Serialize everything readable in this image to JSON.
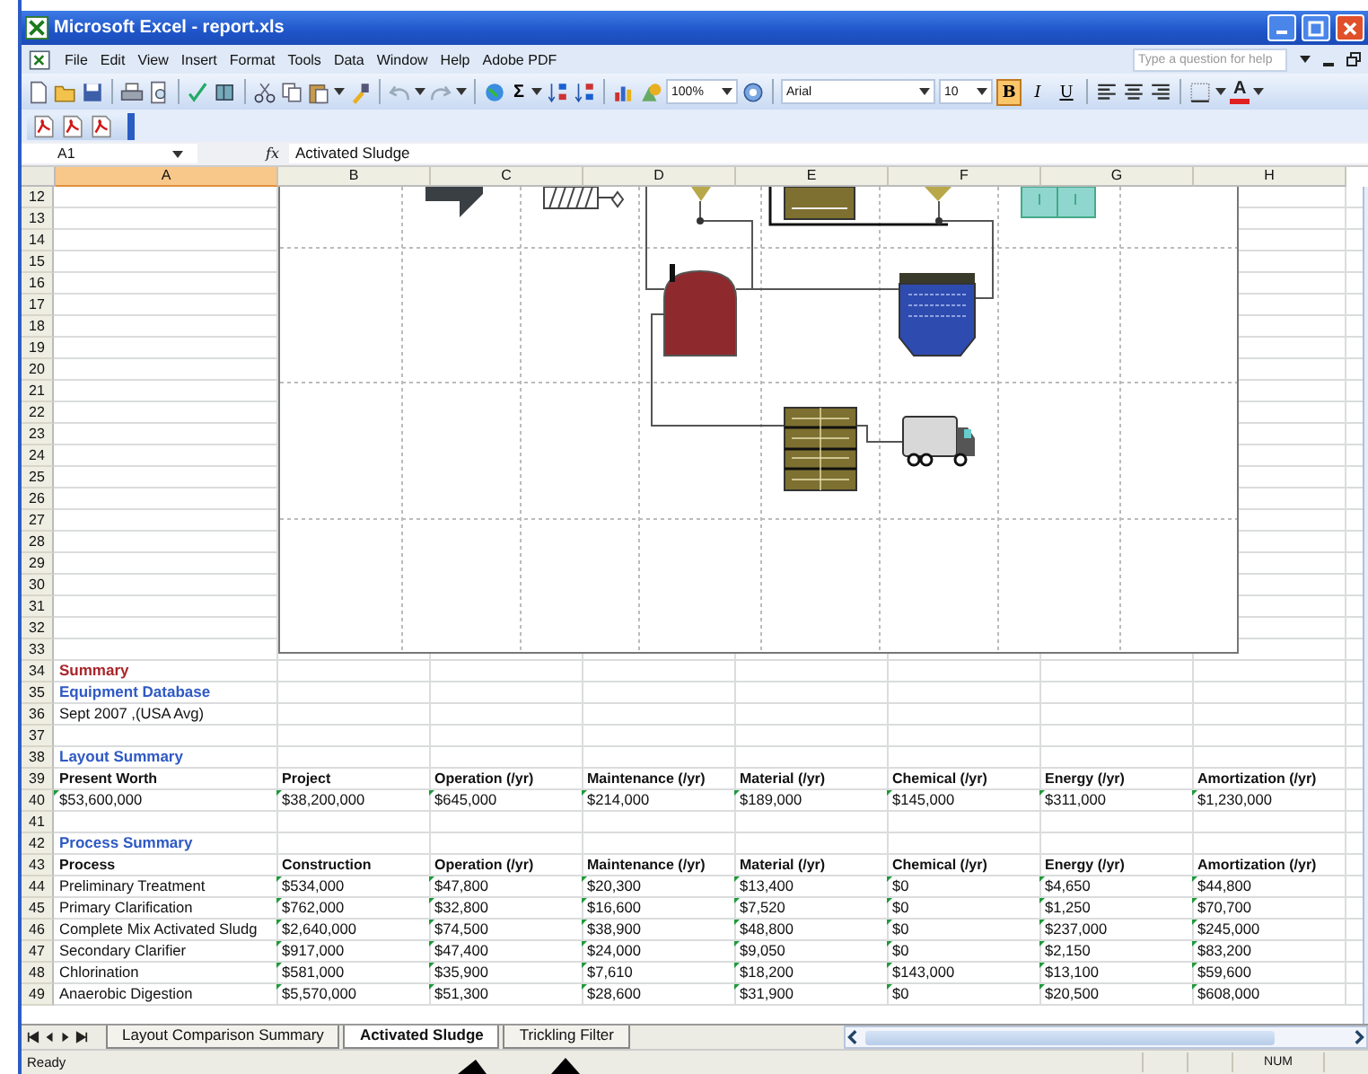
{
  "window": {
    "title": "Microsoft Excel - report.xls"
  },
  "menu": {
    "items": [
      "File",
      "Edit",
      "View",
      "Insert",
      "Format",
      "Tools",
      "Data",
      "Window",
      "Help",
      "Adobe PDF"
    ],
    "help_placeholder": "Type a question for help"
  },
  "toolbar": {
    "sum": "Σ",
    "zoom": "100%",
    "font": "Arial",
    "size": "10",
    "styles": [
      {
        "label": "B",
        "kind": "bold",
        "on": true
      },
      {
        "label": "I",
        "kind": "italic",
        "on": false
      },
      {
        "label": "U",
        "kind": "underline",
        "on": false
      }
    ],
    "font_color": "A"
  },
  "formula_bar": {
    "name_box": "A1",
    "fx": "fx",
    "value": "Activated Sludge"
  },
  "columns": [
    {
      "label": "A",
      "selected": true
    },
    {
      "label": "B",
      "selected": false
    },
    {
      "label": "C",
      "selected": false
    },
    {
      "label": "D",
      "selected": false
    },
    {
      "label": "E",
      "selected": false
    },
    {
      "label": "F",
      "selected": false
    },
    {
      "label": "G",
      "selected": false
    },
    {
      "label": "H",
      "selected": false
    }
  ],
  "rows": [
    {
      "number": "12",
      "kind": "blank"
    },
    {
      "number": "13",
      "kind": "blank"
    },
    {
      "number": "14",
      "kind": "blank"
    },
    {
      "number": "15",
      "kind": "blank"
    },
    {
      "number": "16",
      "kind": "blank"
    },
    {
      "number": "17",
      "kind": "blank"
    },
    {
      "number": "18",
      "kind": "blank"
    },
    {
      "number": "19",
      "kind": "blank"
    },
    {
      "number": "20",
      "kind": "blank"
    },
    {
      "number": "21",
      "kind": "blank"
    },
    {
      "number": "22",
      "kind": "blank"
    },
    {
      "number": "23",
      "kind": "blank"
    },
    {
      "number": "24",
      "kind": "blank"
    },
    {
      "number": "25",
      "kind": "blank"
    },
    {
      "number": "26",
      "kind": "blank"
    },
    {
      "number": "27",
      "kind": "blank"
    },
    {
      "number": "28",
      "kind": "blank"
    },
    {
      "number": "29",
      "kind": "blank"
    },
    {
      "number": "30",
      "kind": "blank"
    },
    {
      "number": "31",
      "kind": "blank"
    },
    {
      "number": "32",
      "kind": "blank"
    },
    {
      "number": "33",
      "kind": "blank"
    },
    {
      "number": "34",
      "kind": "title",
      "cells": [
        "Summary"
      ]
    },
    {
      "number": "35",
      "kind": "section",
      "cells": [
        "Equipment Database"
      ]
    },
    {
      "number": "36",
      "kind": "note",
      "cells": [
        "Sept 2007 ,(USA Avg)"
      ]
    },
    {
      "number": "37",
      "kind": "blank"
    },
    {
      "number": "38",
      "kind": "section",
      "cells": [
        "Layout Summary"
      ]
    },
    {
      "number": "39",
      "kind": "header",
      "cells": [
        "Present Worth",
        "Project",
        "Operation (/yr)",
        "Maintenance (/yr)",
        "Material (/yr)",
        "Chemical (/yr)",
        "Energy (/yr)",
        "Amortization (/yr)"
      ]
    },
    {
      "number": "40",
      "kind": "totals",
      "cells": [
        "$53,600,000",
        "$38,200,000",
        "$645,000",
        "$214,000",
        "$189,000",
        "$145,000",
        "$311,000",
        "$1,230,000"
      ]
    },
    {
      "number": "41",
      "kind": "blank"
    },
    {
      "number": "42",
      "kind": "section",
      "cells": [
        "Process Summary"
      ]
    },
    {
      "number": "43",
      "kind": "header",
      "cells": [
        "Process",
        "Construction",
        "Operation (/yr)",
        "Maintenance (/yr)",
        "Material (/yr)",
        "Chemical (/yr)",
        "Energy (/yr)",
        "Amortization (/yr)"
      ]
    },
    {
      "number": "44",
      "kind": "process",
      "cells": [
        "Preliminary Treatment",
        "$534,000",
        "$47,800",
        "$20,300",
        "$13,400",
        "$0",
        "$4,650",
        "$44,800"
      ]
    },
    {
      "number": "45",
      "kind": "process",
      "cells": [
        "Primary Clarification",
        "$762,000",
        "$32,800",
        "$16,600",
        "$7,520",
        "$0",
        "$1,250",
        "$70,700"
      ]
    },
    {
      "number": "46",
      "kind": "process",
      "cells": [
        "Complete Mix Activated Sludg",
        "$2,640,000",
        "$74,500",
        "$38,900",
        "$48,800",
        "$0",
        "$237,000",
        "$245,000"
      ]
    },
    {
      "number": "47",
      "kind": "process",
      "cells": [
        "Secondary Clarifier",
        "$917,000",
        "$47,400",
        "$24,000",
        "$9,050",
        "$0",
        "$2,150",
        "$83,200"
      ]
    },
    {
      "number": "48",
      "kind": "process",
      "cells": [
        "Chlorination",
        "$581,000",
        "$35,900",
        "$7,610",
        "$18,200",
        "$143,000",
        "$13,100",
        "$59,600"
      ]
    },
    {
      "number": "49",
      "kind": "process",
      "cells": [
        "Anaerobic Digestion",
        "$5,570,000",
        "$51,300",
        "$28,600",
        "$31,900",
        "$0",
        "$20,500",
        "$608,000"
      ]
    }
  ],
  "sheet_tabs": [
    {
      "label": "Layout Comparison Summary",
      "selected": false
    },
    {
      "label": "Activated Sludge",
      "selected": true
    },
    {
      "label": "Trickling Filter",
      "selected": false
    }
  ],
  "status_bar": {
    "text": "Ready",
    "num": "NUM"
  }
}
